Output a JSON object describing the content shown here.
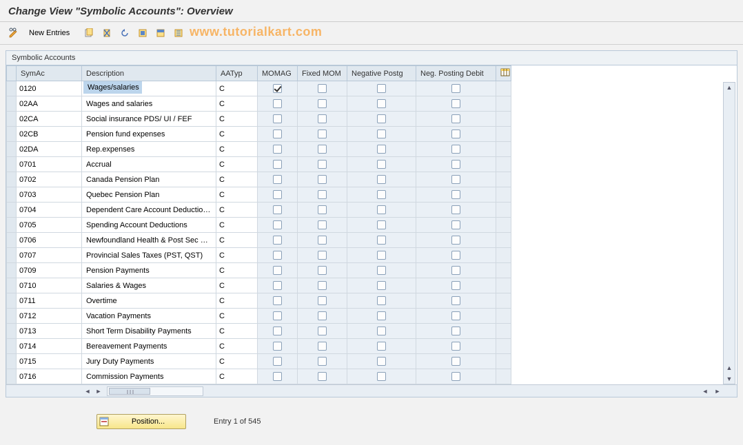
{
  "title": "Change View \"Symbolic Accounts\": Overview",
  "toolbar": {
    "new_entries": "New Entries"
  },
  "watermark": "www.tutorialkart.com",
  "panel": {
    "title": "Symbolic Accounts"
  },
  "columns": {
    "symac": "SymAc",
    "description": "Description",
    "aatyp": "AATyp",
    "momag": "MOMAG",
    "fixed_mom": "Fixed MOM",
    "neg_postg": "Negative Postg",
    "neg_debit": "Neg. Posting Debit"
  },
  "rows": [
    {
      "symac": "0120",
      "description": "Wages/salaries",
      "aatyp": "C",
      "momag": true,
      "fixed_mom": false,
      "neg_postg": false,
      "neg_debit": false,
      "selected": true
    },
    {
      "symac": "02AA",
      "description": "Wages and salaries",
      "aatyp": "C",
      "momag": false,
      "fixed_mom": false,
      "neg_postg": false,
      "neg_debit": false
    },
    {
      "symac": "02CA",
      "description": "Social insurance PDS/ UI / FEF",
      "aatyp": "C",
      "momag": false,
      "fixed_mom": false,
      "neg_postg": false,
      "neg_debit": false
    },
    {
      "symac": "02CB",
      "description": "Pension fund expenses",
      "aatyp": "C",
      "momag": false,
      "fixed_mom": false,
      "neg_postg": false,
      "neg_debit": false
    },
    {
      "symac": "02DA",
      "description": "Rep.expenses",
      "aatyp": "C",
      "momag": false,
      "fixed_mom": false,
      "neg_postg": false,
      "neg_debit": false
    },
    {
      "symac": "0701",
      "description": "Accrual",
      "aatyp": "C",
      "momag": false,
      "fixed_mom": false,
      "neg_postg": false,
      "neg_debit": false
    },
    {
      "symac": "0702",
      "description": "Canada Pension Plan",
      "aatyp": "C",
      "momag": false,
      "fixed_mom": false,
      "neg_postg": false,
      "neg_debit": false
    },
    {
      "symac": "0703",
      "description": "Quebec Pension Plan",
      "aatyp": "C",
      "momag": false,
      "fixed_mom": false,
      "neg_postg": false,
      "neg_debit": false
    },
    {
      "symac": "0704",
      "description": "Dependent Care Account Deductio…",
      "aatyp": "C",
      "momag": false,
      "fixed_mom": false,
      "neg_postg": false,
      "neg_debit": false
    },
    {
      "symac": "0705",
      "description": "Spending Account Deductions",
      "aatyp": "C",
      "momag": false,
      "fixed_mom": false,
      "neg_postg": false,
      "neg_debit": false
    },
    {
      "symac": "0706",
      "description": "Newfoundland Health & Post Sec E…",
      "aatyp": "C",
      "momag": false,
      "fixed_mom": false,
      "neg_postg": false,
      "neg_debit": false
    },
    {
      "symac": "0707",
      "description": "Provincial Sales Taxes (PST, QST)",
      "aatyp": "C",
      "momag": false,
      "fixed_mom": false,
      "neg_postg": false,
      "neg_debit": false
    },
    {
      "symac": "0709",
      "description": "Pension Payments",
      "aatyp": "C",
      "momag": false,
      "fixed_mom": false,
      "neg_postg": false,
      "neg_debit": false
    },
    {
      "symac": "0710",
      "description": "Salaries & Wages",
      "aatyp": "C",
      "momag": false,
      "fixed_mom": false,
      "neg_postg": false,
      "neg_debit": false
    },
    {
      "symac": "0711",
      "description": "Overtime",
      "aatyp": "C",
      "momag": false,
      "fixed_mom": false,
      "neg_postg": false,
      "neg_debit": false
    },
    {
      "symac": "0712",
      "description": "Vacation Payments",
      "aatyp": "C",
      "momag": false,
      "fixed_mom": false,
      "neg_postg": false,
      "neg_debit": false
    },
    {
      "symac": "0713",
      "description": "Short Term Disability Payments",
      "aatyp": "C",
      "momag": false,
      "fixed_mom": false,
      "neg_postg": false,
      "neg_debit": false
    },
    {
      "symac": "0714",
      "description": "Bereavement Payments",
      "aatyp": "C",
      "momag": false,
      "fixed_mom": false,
      "neg_postg": false,
      "neg_debit": false
    },
    {
      "symac": "0715",
      "description": "Jury Duty Payments",
      "aatyp": "C",
      "momag": false,
      "fixed_mom": false,
      "neg_postg": false,
      "neg_debit": false
    },
    {
      "symac": "0716",
      "description": "Commission Payments",
      "aatyp": "C",
      "momag": false,
      "fixed_mom": false,
      "neg_postg": false,
      "neg_debit": false
    }
  ],
  "footer": {
    "position_label": "Position...",
    "entry_text": "Entry 1 of 545"
  }
}
